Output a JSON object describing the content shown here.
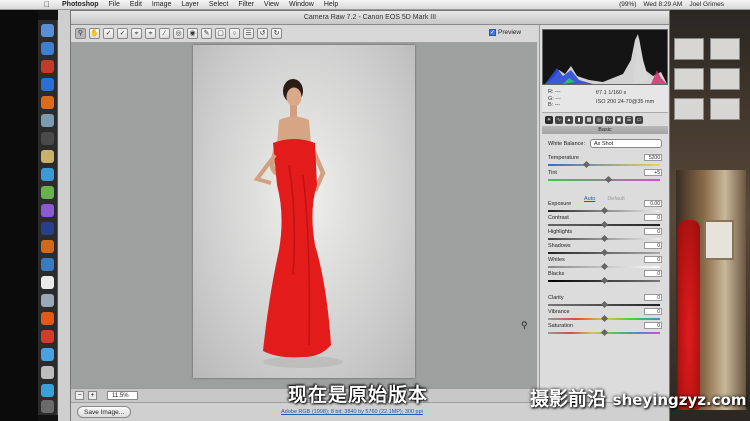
{
  "menubar": {
    "app_name": "Photoshop",
    "menus": [
      "File",
      "Edit",
      "Image",
      "Layer",
      "Select",
      "Filter",
      "View",
      "Window",
      "Help"
    ],
    "battery": "(99%)",
    "clock": "Wed 8:29 AM",
    "user": "Joel Grimes"
  },
  "dialog": {
    "title": "Camera Raw 7.2  -  Canon EOS 5D Mark III",
    "preview_label": "Preview"
  },
  "toolbar": {
    "tools": [
      "zoom-tool",
      "hand-tool",
      "white-balance-tool",
      "color-sampler-tool",
      "targeted-adjustment-tool",
      "crop-tool",
      "straighten-tool",
      "spot-removal-tool",
      "red-eye-removal-tool",
      "adjustment-brush-tool",
      "graduated-filter-tool",
      "radial-filter-tool",
      "preferences-tool",
      "rotate-left-tool",
      "rotate-right-tool"
    ]
  },
  "status": {
    "zoom": "11.5%",
    "save_button": "Save Image...",
    "link_text": "Adobe RGB (1998); 8 bit; 3840 by 5760 (22.1MP); 300 ppi"
  },
  "panel": {
    "rgb_r": "R:  ---",
    "rgb_g": "G:  ---",
    "rgb_b": "B:  ---",
    "aperture_shutter": "f/7.1    1/160 s",
    "iso_lens": "ISO 200    24-70@35 mm",
    "section_title": "Basic",
    "white_balance_label": "White Balance:",
    "white_balance_value": "As Shot",
    "auto": "Auto",
    "default": "Default",
    "sliders": [
      {
        "label": "Temperature",
        "value": "5200"
      },
      {
        "label": "Tint",
        "value": "+5"
      },
      {
        "label": "Exposure",
        "value": "0.00"
      },
      {
        "label": "Contrast",
        "value": "0"
      },
      {
        "label": "Highlights",
        "value": "0"
      },
      {
        "label": "Shadows",
        "value": "0"
      },
      {
        "label": "Whites",
        "value": "0"
      },
      {
        "label": "Blacks",
        "value": "0"
      },
      {
        "label": "Clarity",
        "value": "0"
      },
      {
        "label": "Vibrance",
        "value": "0"
      },
      {
        "label": "Saturation",
        "value": "0"
      }
    ]
  },
  "overlay": {
    "subtitle": "现在是原始版本",
    "watermark_cn": "摄影前沿",
    "watermark_url": "sheyingzyz.com"
  },
  "colors": {
    "accent": "#3a7bd5",
    "dress": "#e01c1c"
  }
}
